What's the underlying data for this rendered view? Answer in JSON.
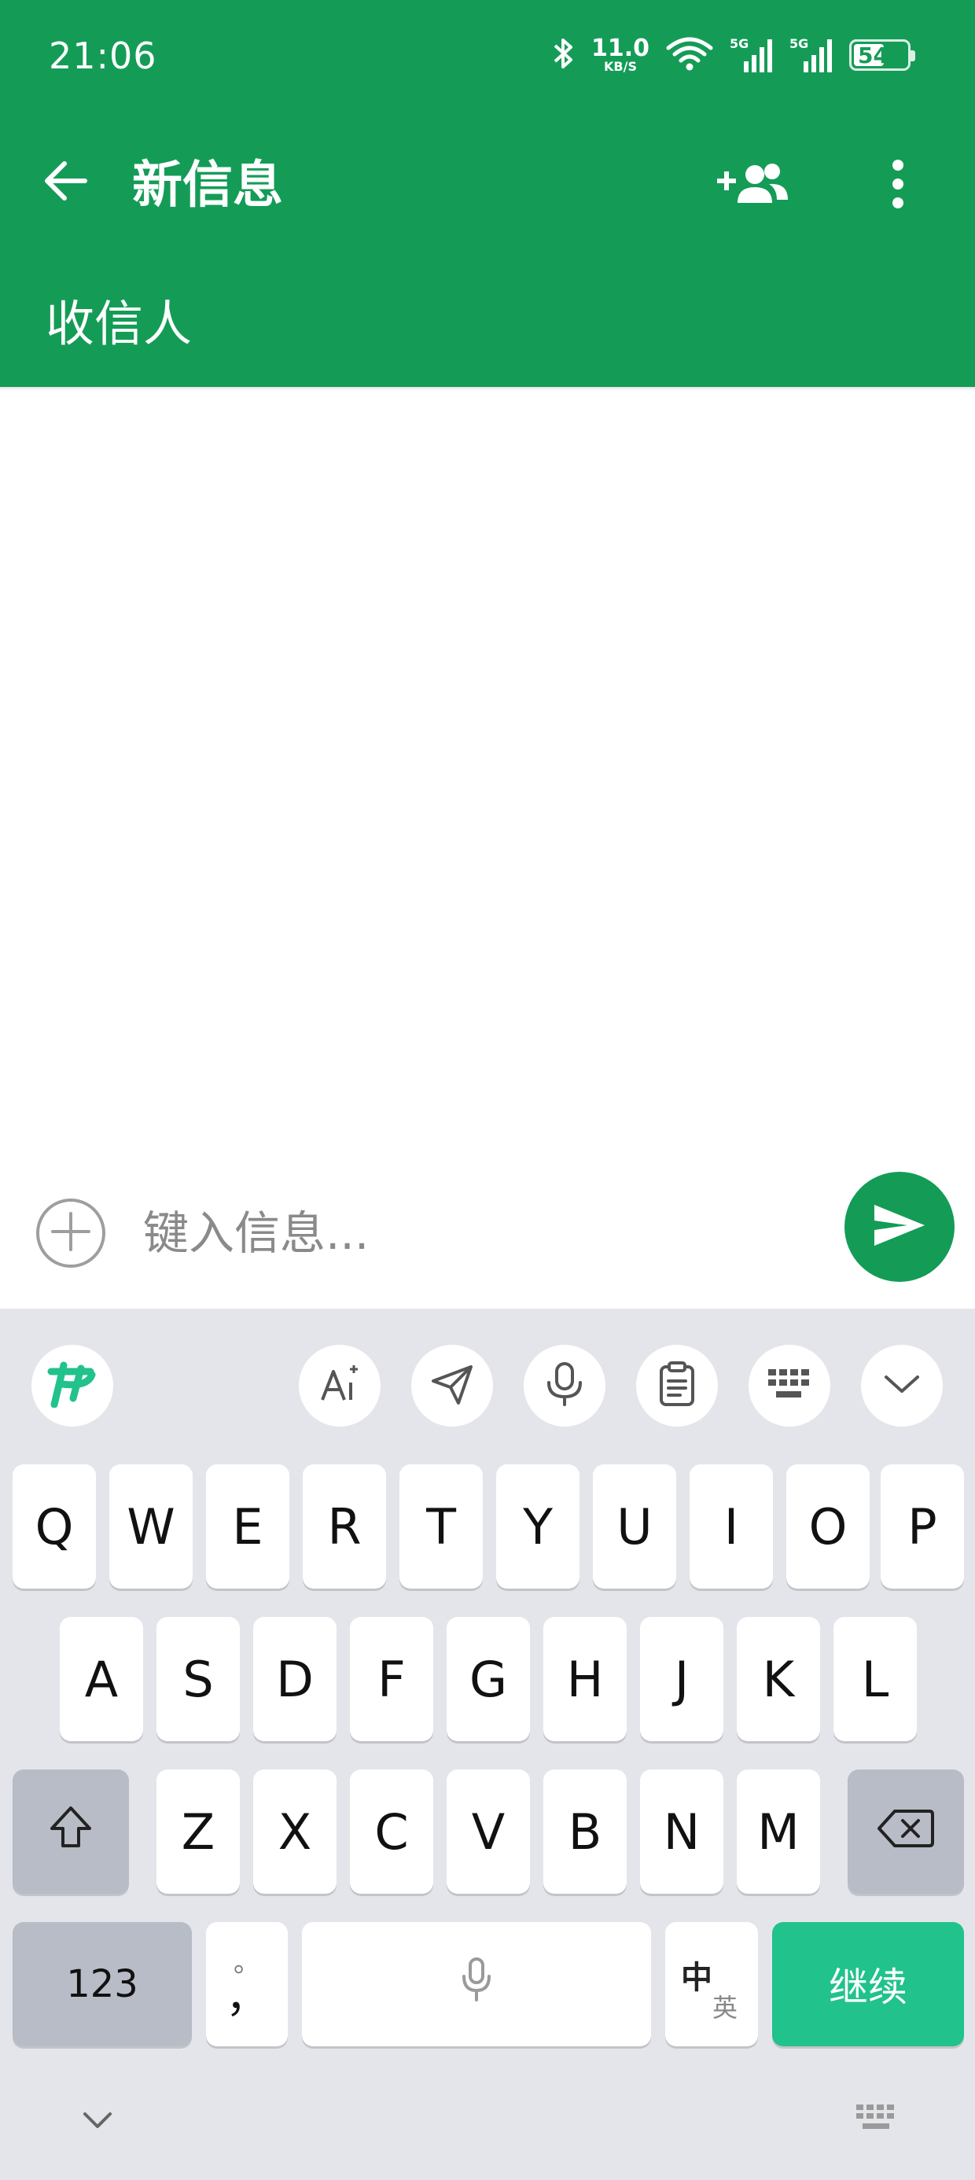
{
  "status_bar": {
    "time": "21:06",
    "net_speed_value": "11.0",
    "net_speed_unit": "KB/S",
    "signal1_label": "5G",
    "signal2_label": "5G",
    "battery": "54",
    "icons": [
      "bluetooth-icon",
      "wifi-icon",
      "signal-icon",
      "signal-icon",
      "battery-icon"
    ]
  },
  "app_bar": {
    "title": "新信息",
    "recipient_label": "收信人",
    "icons": [
      "back-arrow-icon",
      "add-contact-icon",
      "more-vert-icon"
    ]
  },
  "compose": {
    "placeholder": "键入信息...",
    "icons": [
      "add-circle-icon",
      "send-icon"
    ]
  },
  "keyboard": {
    "toolbar_icons": [
      "ime-logo-icon",
      "ai-write-icon",
      "send-plane-icon",
      "microphone-icon",
      "clipboard-icon",
      "keyboard-layout-icon",
      "collapse-chevron-icon"
    ],
    "row1": [
      "Q",
      "W",
      "E",
      "R",
      "T",
      "Y",
      "U",
      "I",
      "O",
      "P"
    ],
    "row2": [
      "A",
      "S",
      "D",
      "F",
      "G",
      "H",
      "J",
      "K",
      "L"
    ],
    "row3": [
      "Z",
      "X",
      "C",
      "V",
      "B",
      "N",
      "M"
    ],
    "numbers_key": "123",
    "punct_top": "。",
    "punct_bottom": "，",
    "lang_primary": "中",
    "lang_secondary": "英",
    "action_key": "继续",
    "colors": {
      "accent": "#149c57",
      "action": "#21c28b",
      "background": "#e4e5ea"
    }
  }
}
